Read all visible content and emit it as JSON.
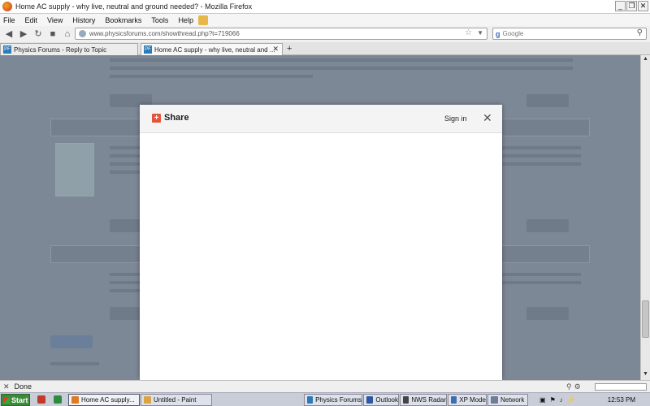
{
  "window": {
    "title": "Home AC supply - why live, neutral and ground needed? - Mozilla Firefox",
    "controls": [
      "_",
      "❐",
      "✕"
    ]
  },
  "menu": [
    "File",
    "Edit",
    "View",
    "History",
    "Bookmarks",
    "Tools",
    "Help"
  ],
  "nav": {
    "url": "www.physicsforums.com/showthread.php?t=719066",
    "search_placeholder": "Google"
  },
  "tabs": [
    {
      "label": "Physics Forums - Reply to Topic",
      "active": false
    },
    {
      "label": "Home AC supply - why live, neutral and ...",
      "active": true
    }
  ],
  "modal": {
    "title": "Share",
    "signin": "Sign in",
    "close": "✕"
  },
  "status": {
    "text": "Done"
  },
  "taskbar": {
    "start": "Start",
    "buttons": [
      "Home AC supply...",
      "Untitled - Paint",
      "Physics Forums",
      "Outlook",
      "NWS Radar",
      "XP Mode",
      "Network"
    ],
    "clock": "12:53 PM"
  },
  "colors": {
    "overlay": "#7d8896",
    "share_accent": "#e2553a",
    "start_green": "#3b8b3b"
  }
}
